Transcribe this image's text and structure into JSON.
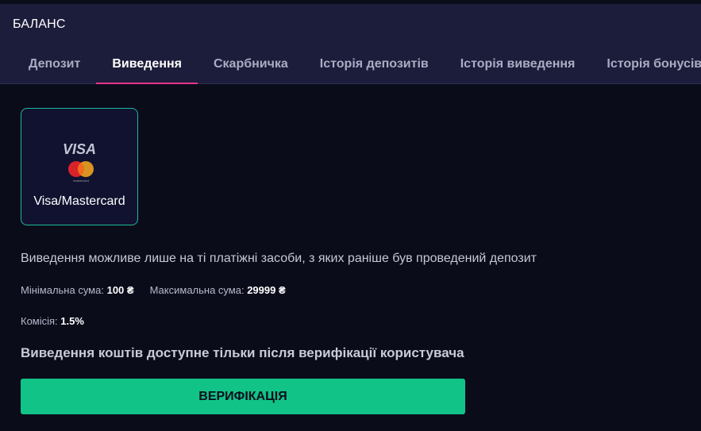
{
  "header": {
    "title": "БАЛАНС",
    "tabs": [
      {
        "label": "Депозит",
        "active": false
      },
      {
        "label": "Виведення",
        "active": true
      },
      {
        "label": "Скарбничка",
        "active": false
      },
      {
        "label": "Історія депозитів",
        "active": false
      },
      {
        "label": "Історія виведення",
        "active": false
      },
      {
        "label": "Історія бонусів",
        "active": false
      }
    ]
  },
  "methods": [
    {
      "label": "Visa/Mastercard",
      "logo_text": "VISA",
      "logo_subtext": "mastercard",
      "icon": "visa-mastercard-icon",
      "selected": true
    }
  ],
  "info_text": "Виведення можливе лише на ті платіжні засоби, з яких раніше був проведений депозит",
  "limits": {
    "min_label": "Мінімальна сума:",
    "min_value": "100 ₴",
    "max_label": "Максимальна сума:",
    "max_value": "29999 ₴"
  },
  "commission": {
    "label": "Комісія:",
    "value": "1.5%"
  },
  "verification_notice": "Виведення коштів доступне тільки після верифікації користувача",
  "verify_button": "ВЕРИФІКАЦІЯ",
  "colors": {
    "background": "#0b0c1a",
    "header_bg": "#1c1d3a",
    "active_tab_underline": "#e8348a",
    "card_border": "#1fb99a",
    "button": "#11c387"
  }
}
